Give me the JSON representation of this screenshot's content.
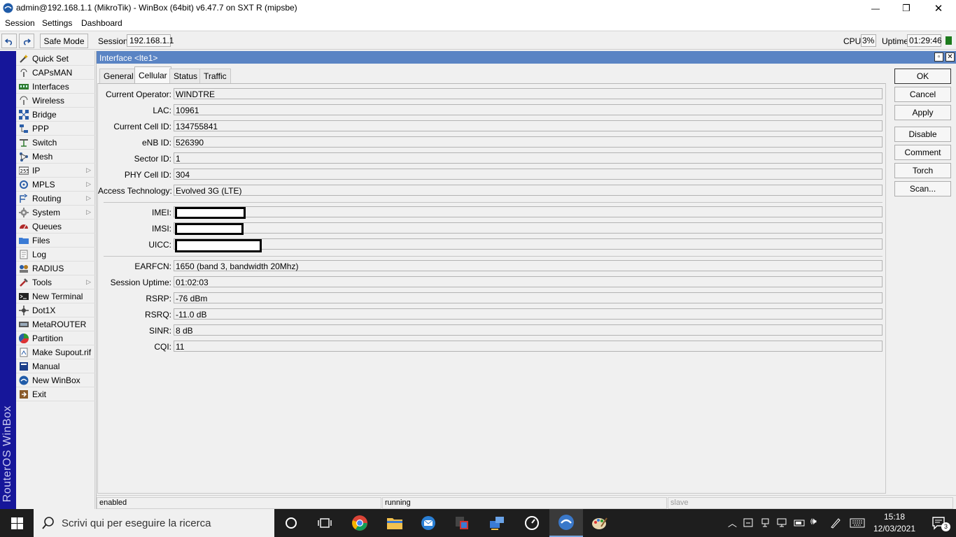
{
  "window": {
    "title": "admin@192.168.1.1 (MikroTik) - WinBox (64bit) v6.47.7 on SXT R (mipsbe)",
    "minimize_glyph": "—",
    "maximize_glyph": "❐",
    "close_glyph": "✕"
  },
  "menubar": {
    "session": "Session",
    "settings": "Settings",
    "dashboard": "Dashboard"
  },
  "toolbar": {
    "safe_mode": "Safe Mode",
    "session_label": "Session:",
    "session_value": "192.168.1.1",
    "cpu_label": "CPU:",
    "cpu_value": "3%",
    "uptime_label": "Uptime:",
    "uptime_value": "01:29:46"
  },
  "brand": "RouterOS WinBox",
  "sidebar": {
    "items": [
      {
        "label": "Quick Set",
        "icon": "wand-icon",
        "submenu": false
      },
      {
        "label": "CAPsMAN",
        "icon": "antenna-icon",
        "submenu": false
      },
      {
        "label": "Interfaces",
        "icon": "interfaces-icon",
        "submenu": false
      },
      {
        "label": "Wireless",
        "icon": "wireless-icon",
        "submenu": false
      },
      {
        "label": "Bridge",
        "icon": "bridge-icon",
        "submenu": false
      },
      {
        "label": "PPP",
        "icon": "ppp-icon",
        "submenu": false
      },
      {
        "label": "Switch",
        "icon": "switch-icon",
        "submenu": false
      },
      {
        "label": "Mesh",
        "icon": "mesh-icon",
        "submenu": false
      },
      {
        "label": "IP",
        "icon": "ip-icon",
        "submenu": true
      },
      {
        "label": "MPLS",
        "icon": "mpls-icon",
        "submenu": true
      },
      {
        "label": "Routing",
        "icon": "routing-icon",
        "submenu": true
      },
      {
        "label": "System",
        "icon": "gear-icon",
        "submenu": true
      },
      {
        "label": "Queues",
        "icon": "queues-icon",
        "submenu": false
      },
      {
        "label": "Files",
        "icon": "folder-icon",
        "submenu": false
      },
      {
        "label": "Log",
        "icon": "log-icon",
        "submenu": false
      },
      {
        "label": "RADIUS",
        "icon": "radius-icon",
        "submenu": false
      },
      {
        "label": "Tools",
        "icon": "tools-icon",
        "submenu": true
      },
      {
        "label": "New Terminal",
        "icon": "terminal-icon",
        "submenu": false
      },
      {
        "label": "Dot1X",
        "icon": "dot1x-icon",
        "submenu": false
      },
      {
        "label": "MetaROUTER",
        "icon": "metarouter-icon",
        "submenu": false
      },
      {
        "label": "Partition",
        "icon": "partition-icon",
        "submenu": false
      },
      {
        "label": "Make Supout.rif",
        "icon": "supout-icon",
        "submenu": false
      },
      {
        "label": "Manual",
        "icon": "manual-icon",
        "submenu": false
      },
      {
        "label": "New WinBox",
        "icon": "winbox-icon",
        "submenu": false
      },
      {
        "label": "Exit",
        "icon": "exit-icon",
        "submenu": false
      }
    ]
  },
  "dialog": {
    "title": "Interface <lte1>",
    "tabs": [
      {
        "label": "General",
        "active": false
      },
      {
        "label": "Cellular",
        "active": true
      },
      {
        "label": "Status",
        "active": false
      },
      {
        "label": "Traffic",
        "active": false
      }
    ],
    "fields": {
      "current_operator": {
        "label": "Current Operator:",
        "value": "WINDTRE"
      },
      "lac": {
        "label": "LAC:",
        "value": "10961"
      },
      "current_cell_id": {
        "label": "Current Cell ID:",
        "value": "134755841"
      },
      "enb_id": {
        "label": "eNB ID:",
        "value": "526390"
      },
      "sector_id": {
        "label": "Sector ID:",
        "value": "1"
      },
      "phy_cell_id": {
        "label": "PHY Cell ID:",
        "value": "304"
      },
      "access_technology": {
        "label": "Access Technology:",
        "value": "Evolved 3G (LTE)"
      },
      "imei": {
        "label": "IMEI:",
        "value": ""
      },
      "imsi": {
        "label": "IMSI:",
        "value": ""
      },
      "uicc": {
        "label": "UICC:",
        "value": ""
      },
      "earfcn": {
        "label": "EARFCN:",
        "value": "1650 (band 3, bandwidth 20Mhz)"
      },
      "session_uptime": {
        "label": "Session Uptime:",
        "value": "01:02:03"
      },
      "rsrp": {
        "label": "RSRP:",
        "value": "-76 dBm"
      },
      "rsrq": {
        "label": "RSRQ:",
        "value": "-11.0 dB"
      },
      "sinr": {
        "label": "SINR:",
        "value": "8 dB"
      },
      "cqi": {
        "label": "CQI:",
        "value": "11"
      }
    },
    "buttons": {
      "ok": "OK",
      "cancel": "Cancel",
      "apply": "Apply",
      "disable": "Disable",
      "comment": "Comment",
      "torch": "Torch",
      "scan": "Scan..."
    },
    "status": {
      "left": "enabled",
      "middle": "running",
      "right": "slave"
    }
  },
  "taskbar": {
    "search_placeholder": "Scrivi qui per eseguire la ricerca",
    "time": "15:18",
    "date": "12/03/2021",
    "notification_count": "3"
  },
  "colors": {
    "title_blue": "#5a84c4",
    "brand_strip": "#16169a",
    "cpu_indicator": "#1c7a1c"
  }
}
